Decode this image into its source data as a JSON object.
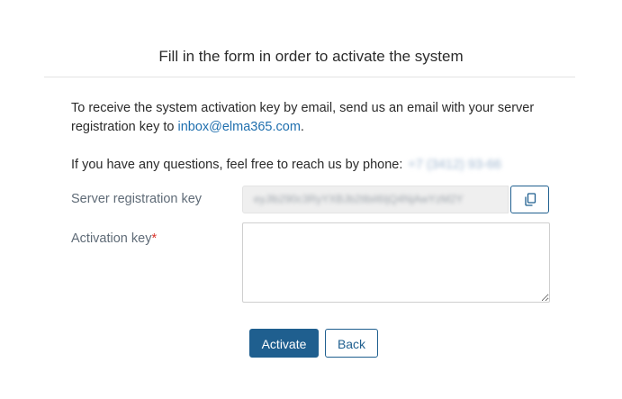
{
  "dialog": {
    "title": "Fill in the form in order to activate the system"
  },
  "info": {
    "email_text_before": "To receive the system activation key by email, send us an email with your server registration key to ",
    "email_link": "inbox@elma365.com",
    "email_text_after": ".",
    "phone_text": "If you have any questions, feel free to reach us by phone: ",
    "phone_number": "+7 (3412) 93-66"
  },
  "form": {
    "server_key_label": "Server registration key",
    "server_key_value": "eyJlb290c3RyYXBJb2tlbiI6IjQ4NjAwYzM2Y",
    "activation_key_label": "Activation key",
    "required_mark": "*",
    "activation_key_value": ""
  },
  "buttons": {
    "activate": "Activate",
    "back": "Back"
  },
  "icons": {
    "copy": "copy-icon"
  },
  "colors": {
    "primary": "#1f5f8f",
    "link": "#1f6fae",
    "required": "#d9342b",
    "label": "#5f6b77"
  }
}
